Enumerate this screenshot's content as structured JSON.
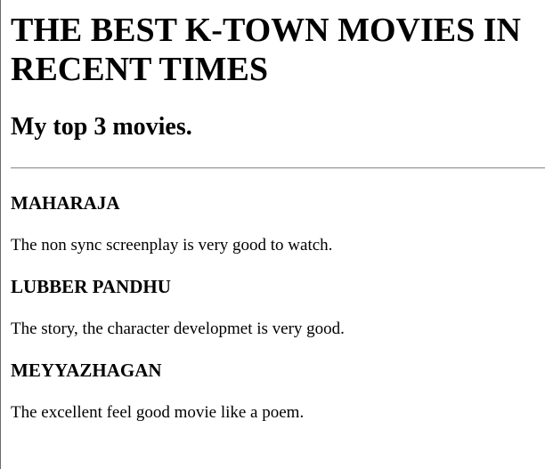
{
  "page": {
    "title_line_1": "THE BEST K-TOWN MOVIES IN",
    "title_line_2": "RECENT TIMES",
    "subtitle": "My top 3 movies.",
    "movies": [
      {
        "name": "MAHARAJA",
        "review": "The non sync screenplay is very good to watch."
      },
      {
        "name": "LUBBER PANDHU",
        "review": "The story, the character developmet is very good."
      },
      {
        "name": "MEYYAZHAGAN",
        "review": "The excellent feel good movie like a poem."
      }
    ]
  }
}
